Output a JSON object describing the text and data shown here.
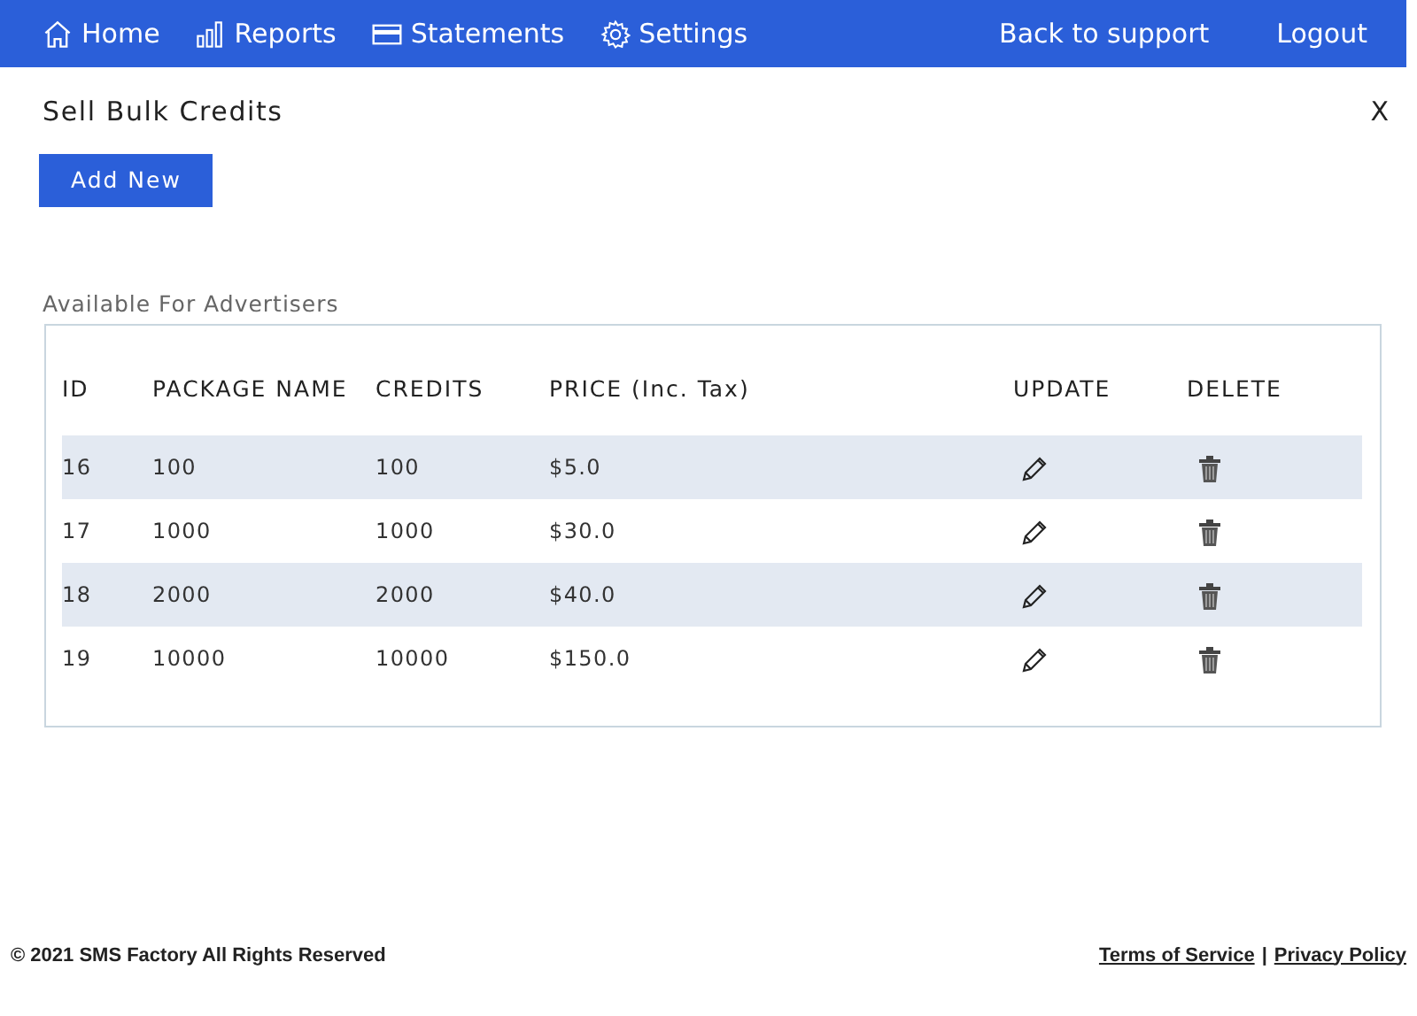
{
  "nav": {
    "items": [
      {
        "label": "Home",
        "kind": "home"
      },
      {
        "label": "Reports",
        "kind": "chart"
      },
      {
        "label": "Statements",
        "kind": "card"
      },
      {
        "label": "Settings",
        "kind": "gear"
      }
    ],
    "right_links": [
      "Back to support",
      "Logout"
    ]
  },
  "page": {
    "title": "Sell Bulk Credits",
    "close": "X",
    "add_button": "Add New",
    "section_label": "Available For Advertisers"
  },
  "table": {
    "columns": [
      "ID",
      "PACKAGE NAME",
      "CREDITS",
      "PRICE (Inc. Tax)",
      "UPDATE",
      "DELETE"
    ],
    "rows": [
      {
        "id": "16",
        "name": "100",
        "credits": "100",
        "price": "$5.0"
      },
      {
        "id": "17",
        "name": "1000",
        "credits": "1000",
        "price": "$30.0"
      },
      {
        "id": "18",
        "name": "2000",
        "credits": "2000",
        "price": "$40.0"
      },
      {
        "id": "19",
        "name": "10000",
        "credits": "10000",
        "price": "$150.0"
      }
    ]
  },
  "footer": {
    "copyright": "© 2021 SMS Factory All Rights Reserved",
    "links": [
      "Terms of Service",
      "Privacy Policy"
    ],
    "separator": "|"
  }
}
